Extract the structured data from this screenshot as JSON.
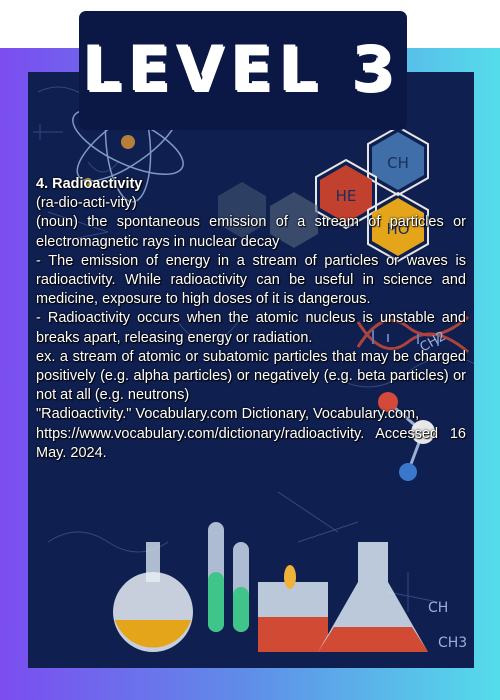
{
  "title": "LEVEL 3",
  "entry": {
    "heading": "4. Radioactivity",
    "pronunciation": "(ra-dio-acti-vity)",
    "definition": "(noun) the spontaneous emission of a stream of particles or electromagnetic rays in nuclear decay",
    "explanation_1": "- The emission of energy in a stream of particles or waves is radioactivity. While radioactivity can be useful in science and medicine, exposure to high doses of it is dangerous.",
    "explanation_2": "- Radioactivity occurs when the atomic nucleus is unstable and breaks apart, releasing energy or radiation.",
    "example": "ex. a stream of atomic or subatomic particles that may be charged positively (e.g. alpha particles) or negatively (e.g. beta particles) or not at all (e.g. neutrons)",
    "citation_1": "\"Radioactivity.\" Vocabulary.com Dictionary, Vocabulary.com,",
    "citation_2": "https://www.vocabulary.com/dictionary/radioactivity. Accessed 16 May. 2024."
  },
  "decor": {
    "hexagon_labels": [
      "CH",
      "HE",
      "HO"
    ],
    "formula_labels": [
      "CH2",
      "CH3",
      "CH"
    ]
  },
  "colors": {
    "board": "#0f1f4f",
    "hex_red": "#c2412e",
    "hex_blue": "#3f6ea8",
    "hex_yellow": "#e4a51a"
  }
}
